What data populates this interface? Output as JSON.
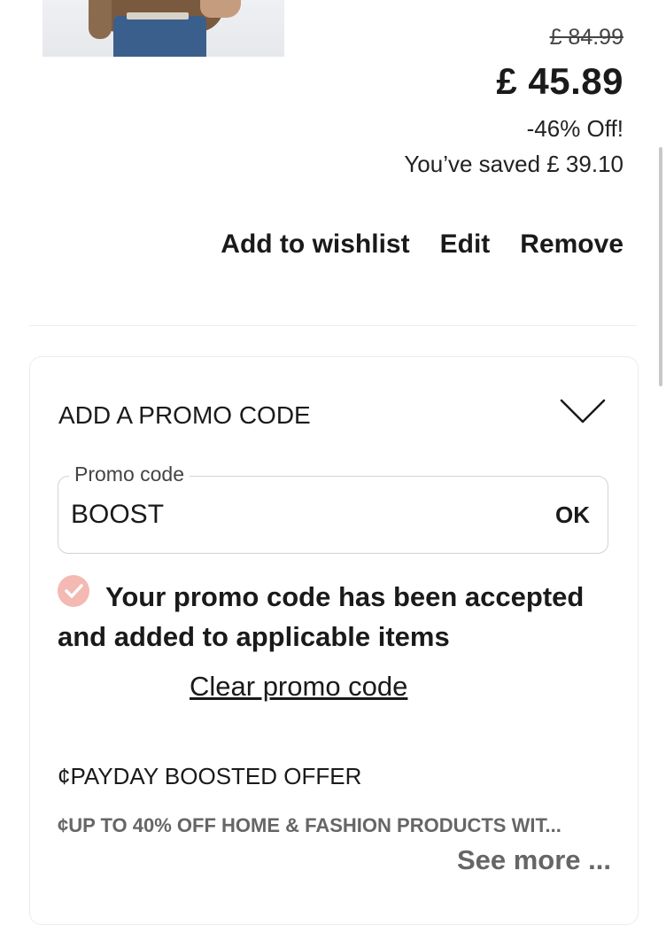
{
  "product": {
    "original_price": "£ 84.99",
    "price": "£ 45.89",
    "discount": "-46% Off!",
    "saved": "You’ve saved £ 39.10"
  },
  "actions": {
    "wishlist_label": "Add to wishlist",
    "edit_label": "Edit",
    "remove_label": "Remove"
  },
  "promo": {
    "title": "ADD A PROMO CODE",
    "field_label": "Promo code",
    "field_value": "BOOST",
    "ok_label": "OK",
    "accepted_message": "Your promo code has been accepted and added to applicable items",
    "clear_label": "Clear promo code",
    "offer_title": "¢PAYDAY BOOSTED OFFER",
    "offer_description": "¢UP TO 40% OFF HOME & FASHION PRODUCTS WIT...",
    "see_more_label": "See more ..."
  },
  "colors": {
    "check_accent": "#f4b9b2",
    "muted_text": "#666666"
  },
  "icons": {
    "chevron": "chevron-down-icon",
    "check": "check-circle-icon"
  }
}
